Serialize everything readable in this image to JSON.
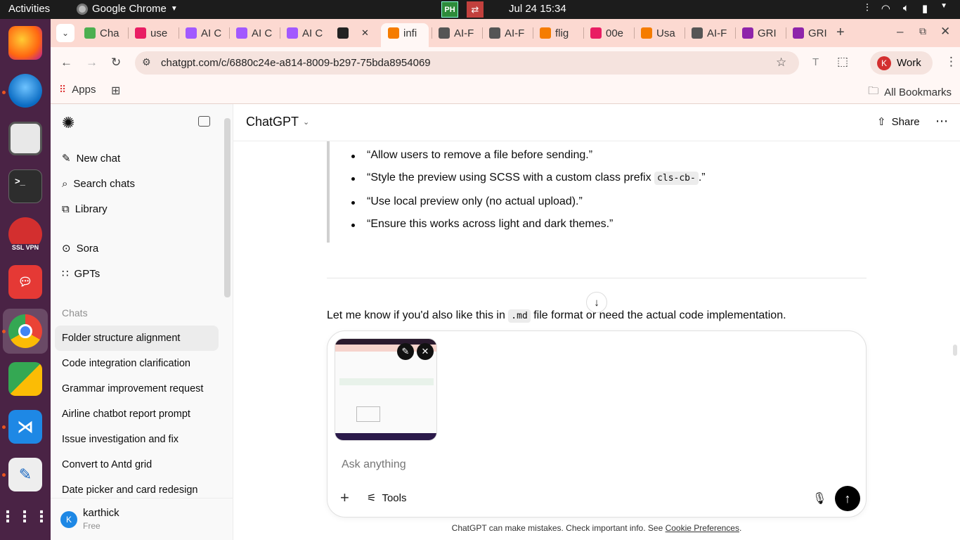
{
  "os": {
    "activities": "Activities",
    "app_name": "Google Chrome",
    "clock": "Jul 24  15:34",
    "tray_ph": "PH"
  },
  "dock": {
    "ssl_vpn_label": "SSL VPN"
  },
  "browser": {
    "tabs": [
      {
        "label": "Cha",
        "color": "#4caf50"
      },
      {
        "label": "use",
        "color": "#e91e63"
      },
      {
        "label": "AI C",
        "color": "#a259ff"
      },
      {
        "label": "AI C",
        "color": "#a259ff"
      },
      {
        "label": "AI C",
        "color": "#a259ff"
      },
      {
        "label": "",
        "color": "#222222"
      },
      {
        "label": "infi",
        "color": "#f57c00"
      },
      {
        "label": "AI-F",
        "color": "#555555"
      },
      {
        "label": "AI-F",
        "color": "#555555"
      },
      {
        "label": "flig",
        "color": "#f57c00"
      },
      {
        "label": "00e",
        "color": "#e91e63"
      },
      {
        "label": "Usa",
        "color": "#f57c00"
      },
      {
        "label": "AI-F",
        "color": "#555555"
      },
      {
        "label": "GRI",
        "color": "#8e24aa"
      },
      {
        "label": "GRI",
        "color": "#8e24aa"
      }
    ],
    "url": "chatgpt.com/c/6880c24e-a814-8009-b297-75bda8954069",
    "profile_initial": "K",
    "profile_label": "Work",
    "apps_label": "Apps",
    "all_bookmarks": "All Bookmarks"
  },
  "sidebar": {
    "nav": [
      {
        "label": "New chat",
        "icon": "edit-icon"
      },
      {
        "label": "Search chats",
        "icon": "search-icon"
      },
      {
        "label": "Library",
        "icon": "library-icon"
      }
    ],
    "extra": [
      {
        "label": "Sora",
        "icon": "play-icon"
      },
      {
        "label": "GPTs",
        "icon": "grid-icon"
      }
    ],
    "chats_heading": "Chats",
    "chats": [
      "Folder structure alignment",
      "Code integration clarification",
      "Grammar improvement request",
      "Airline chatbot report prompt",
      "Issue investigation and fix",
      "Convert to Antd grid",
      "Date picker and card redesign"
    ],
    "user": {
      "initial": "K",
      "name": "karthick",
      "plan": "Free"
    }
  },
  "header": {
    "title": "ChatGPT",
    "share": "Share"
  },
  "conversation": {
    "bullets": [
      {
        "text": "“Allow users to remove a file before sending.”"
      },
      {
        "before": "“Style the preview using SCSS with a custom class prefix ",
        "code": "cls-cb-",
        "after": ".”"
      },
      {
        "text": "“Use local preview only (no actual upload).”"
      },
      {
        "text": "“Ensure this works across light and dark themes.”"
      }
    ],
    "final": {
      "before": "Let me know if you'd also like this in ",
      "code": ".md",
      "after": " file format or need the actual code implementation."
    }
  },
  "composer": {
    "placeholder": "Ask anything",
    "tools": "Tools"
  },
  "footer": {
    "text": "ChatGPT can make mistakes. Check important info. See ",
    "link": "Cookie Preferences",
    "end": "."
  }
}
